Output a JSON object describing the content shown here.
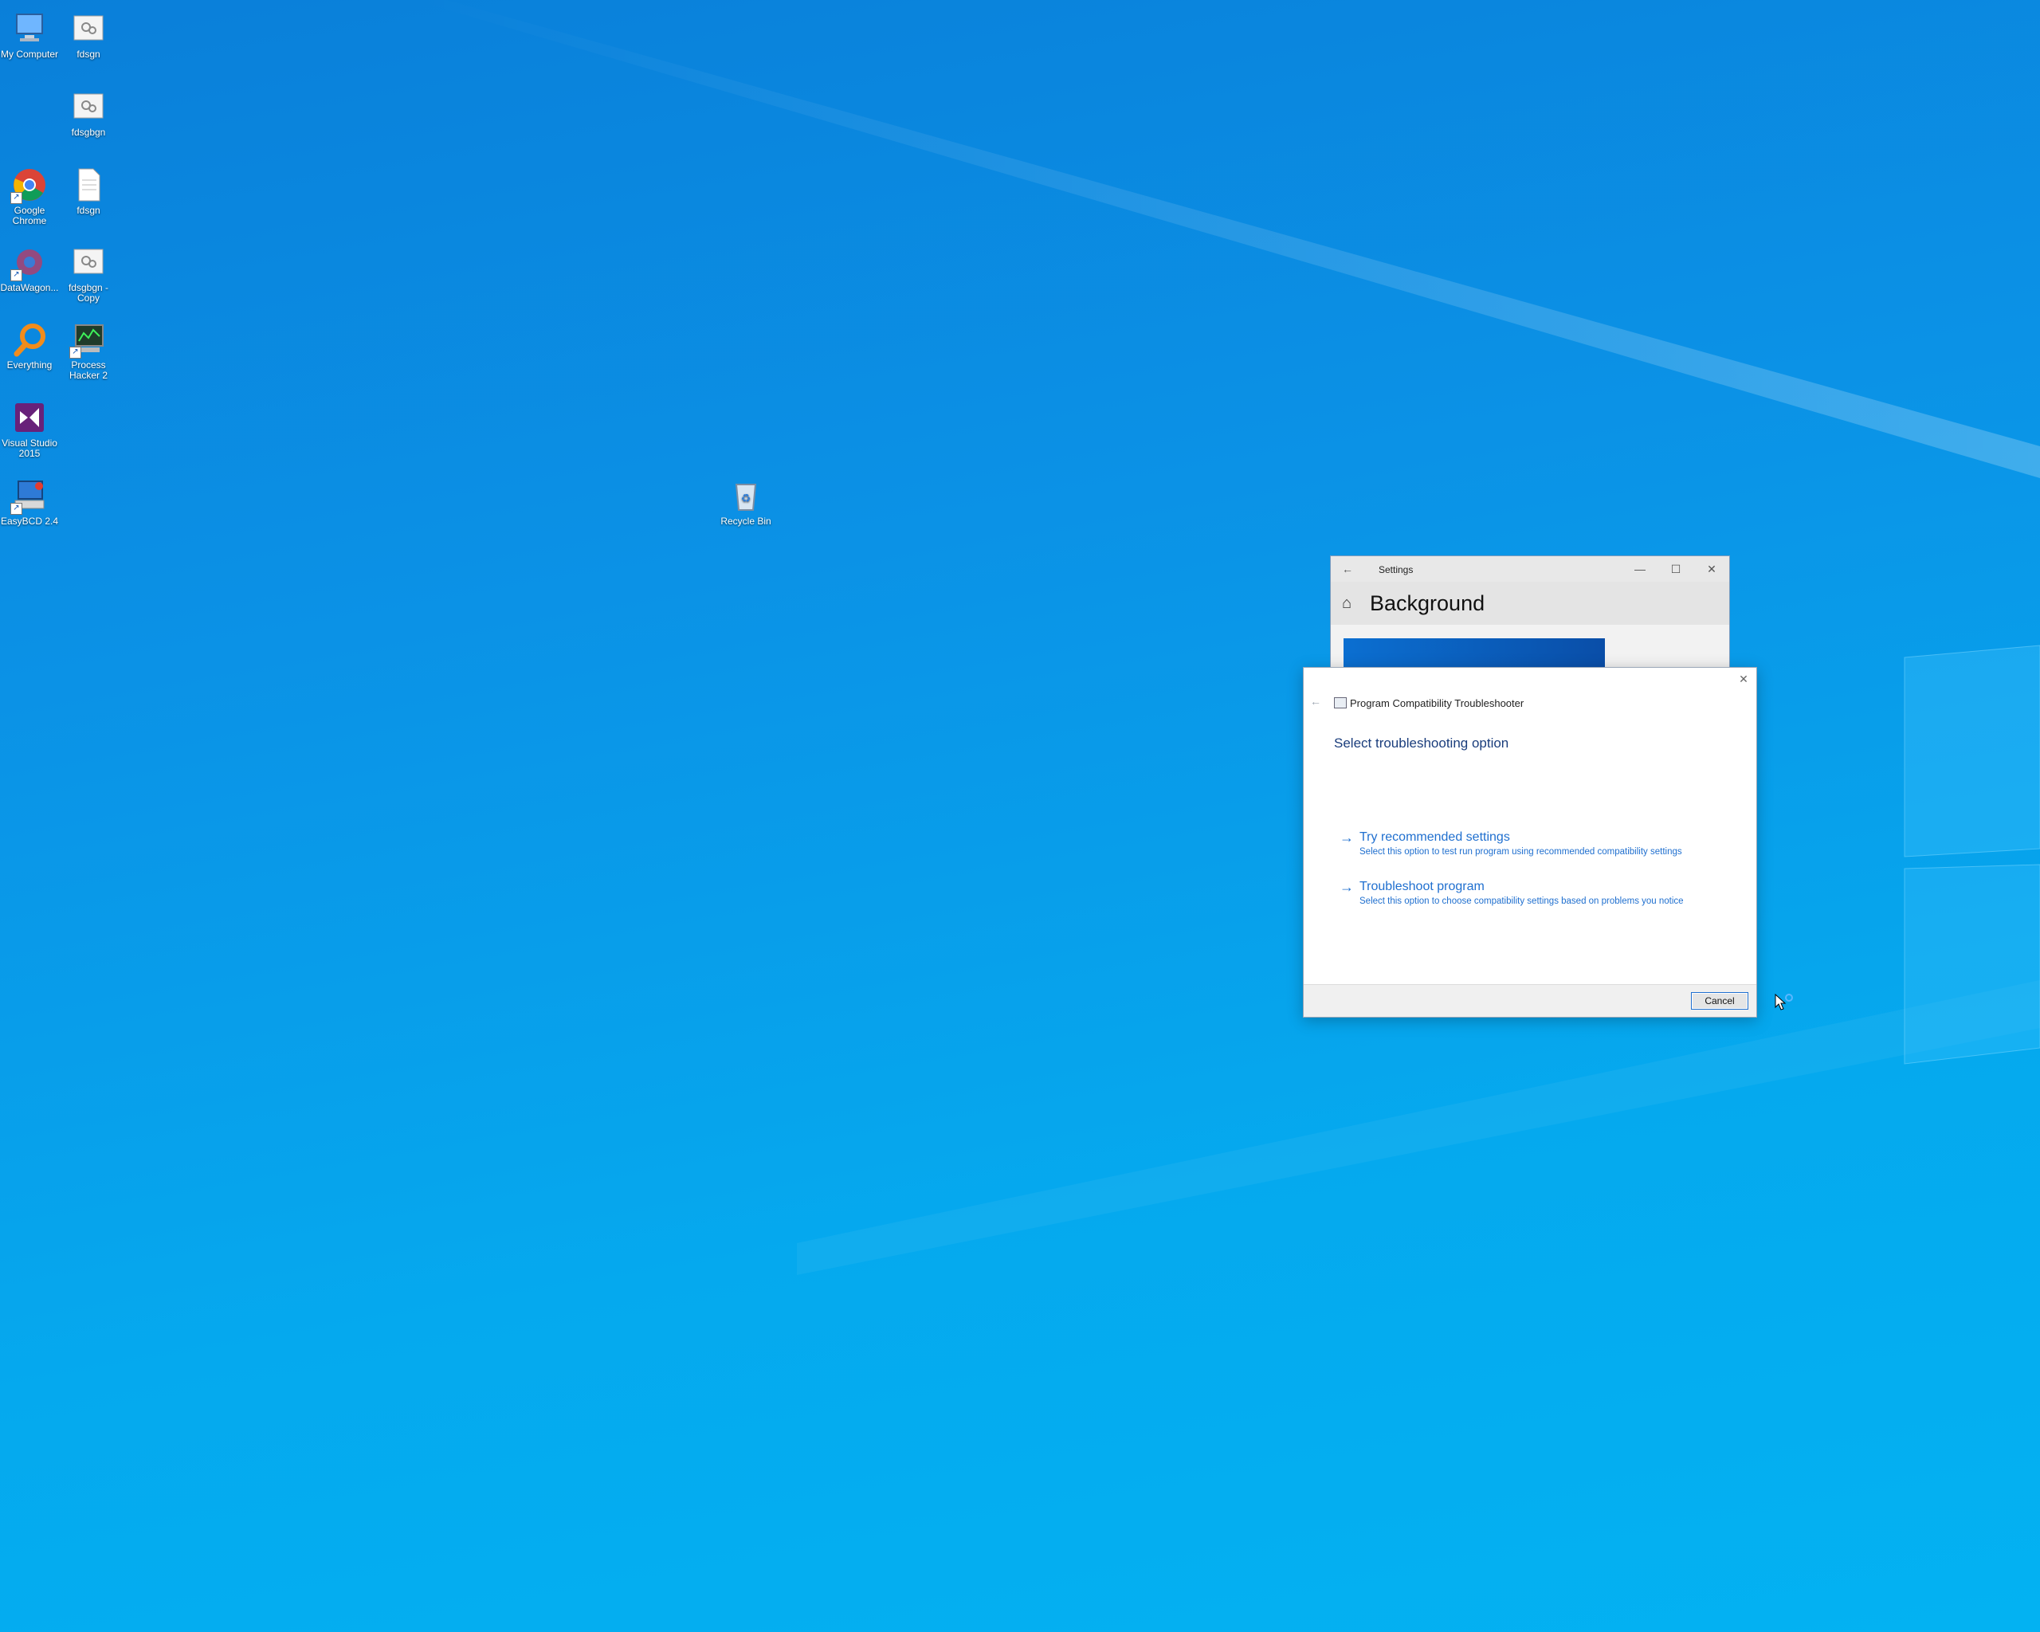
{
  "desktop": {
    "icons": [
      {
        "label": "My Computer",
        "icon": "computer-icon"
      },
      {
        "label": "fdsgn",
        "icon": "settings-file-icon"
      },
      {
        "label": "fdsgbgn",
        "icon": "settings-file-icon"
      },
      {
        "label": "Google Chrome",
        "icon": "chrome-icon"
      },
      {
        "label": "fdsgn",
        "icon": "text-file-icon"
      },
      {
        "label": "DataWagon...",
        "icon": "gear-app-icon"
      },
      {
        "label": "fdsgbgn - Copy",
        "icon": "settings-file-icon"
      },
      {
        "label": "Everything",
        "icon": "search-app-icon"
      },
      {
        "label": "Process Hacker 2",
        "icon": "process-hacker-icon"
      },
      {
        "label": "Visual Studio 2015",
        "icon": "visual-studio-icon"
      },
      {
        "label": "EasyBCD 2.4",
        "icon": "easybcd-icon"
      },
      {
        "label": "Recycle Bin",
        "icon": "recycle-bin-icon"
      }
    ]
  },
  "settings_window": {
    "title": "Settings",
    "heading": "Background",
    "back_glyph": "←",
    "home_glyph": "⌂",
    "minimize_glyph": "—",
    "maximize_glyph": "☐",
    "close_glyph": "✕"
  },
  "troubleshooter": {
    "title": "Program Compatibility Troubleshooter",
    "heading": "Select troubleshooting option",
    "back_glyph": "←",
    "close_glyph": "✕",
    "options": [
      {
        "title": "Try recommended settings",
        "description": "Select this option to test run program using recommended compatibility settings",
        "arrow": "→"
      },
      {
        "title": "Troubleshoot program",
        "description": "Select this option to choose compatibility settings based on problems you notice",
        "arrow": "→"
      }
    ],
    "cancel_label": "Cancel"
  },
  "colors": {
    "desktop_blue": "#0a92e6",
    "link_blue": "#1f6fcf",
    "heading_navy": "#1a3d7c"
  }
}
